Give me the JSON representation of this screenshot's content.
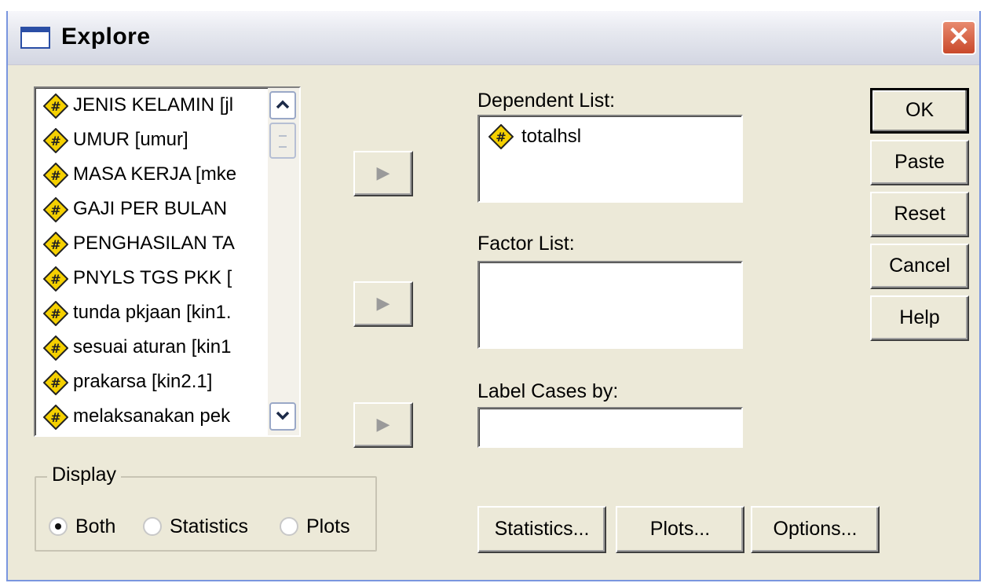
{
  "window": {
    "title": "Explore",
    "close_glyph": "✕"
  },
  "colors": {
    "window_bg": "#ece9d8",
    "title_bg": "#e6e8ef",
    "close_red": "#c9492b",
    "scale_icon_fill": "#f5d000"
  },
  "variables": [
    {
      "label": "JENIS KELAMIN [jl",
      "icon": "scale-variable-icon"
    },
    {
      "label": "UMUR [umur]",
      "icon": "scale-variable-icon"
    },
    {
      "label": "MASA KERJA [mke",
      "icon": "scale-variable-icon"
    },
    {
      "label": "GAJI PER BULAN",
      "icon": "scale-variable-icon"
    },
    {
      "label": "PENGHASILAN TA",
      "icon": "scale-variable-icon"
    },
    {
      "label": "PNYLS TGS PKK [",
      "icon": "scale-variable-icon"
    },
    {
      "label": "tunda pkjaan [kin1.",
      "icon": "scale-variable-icon"
    },
    {
      "label": "sesuai aturan [kin1",
      "icon": "scale-variable-icon"
    },
    {
      "label": "prakarsa [kin2.1]",
      "icon": "scale-variable-icon"
    },
    {
      "label": "melaksanakan pek",
      "icon": "scale-variable-icon"
    }
  ],
  "scroll": {
    "up": "⌃",
    "down": "⌄"
  },
  "move_arrow": "▶",
  "dependent": {
    "label": "Dependent List:",
    "items": [
      {
        "label": "totalhsl",
        "icon": "scale-variable-icon"
      }
    ]
  },
  "factor": {
    "label": "Factor List:"
  },
  "label_cases": {
    "label": "Label Cases by:",
    "value": ""
  },
  "buttons": {
    "ok": "OK",
    "paste": "Paste",
    "reset": "Reset",
    "cancel": "Cancel",
    "help": "Help",
    "statistics": "Statistics...",
    "plots": "Plots...",
    "options": "Options..."
  },
  "display": {
    "title": "Display",
    "selected": "Both",
    "options": [
      {
        "label": "Both",
        "checked": true
      },
      {
        "label": "Statistics",
        "checked": false
      },
      {
        "label": "Plots",
        "checked": false
      }
    ]
  }
}
